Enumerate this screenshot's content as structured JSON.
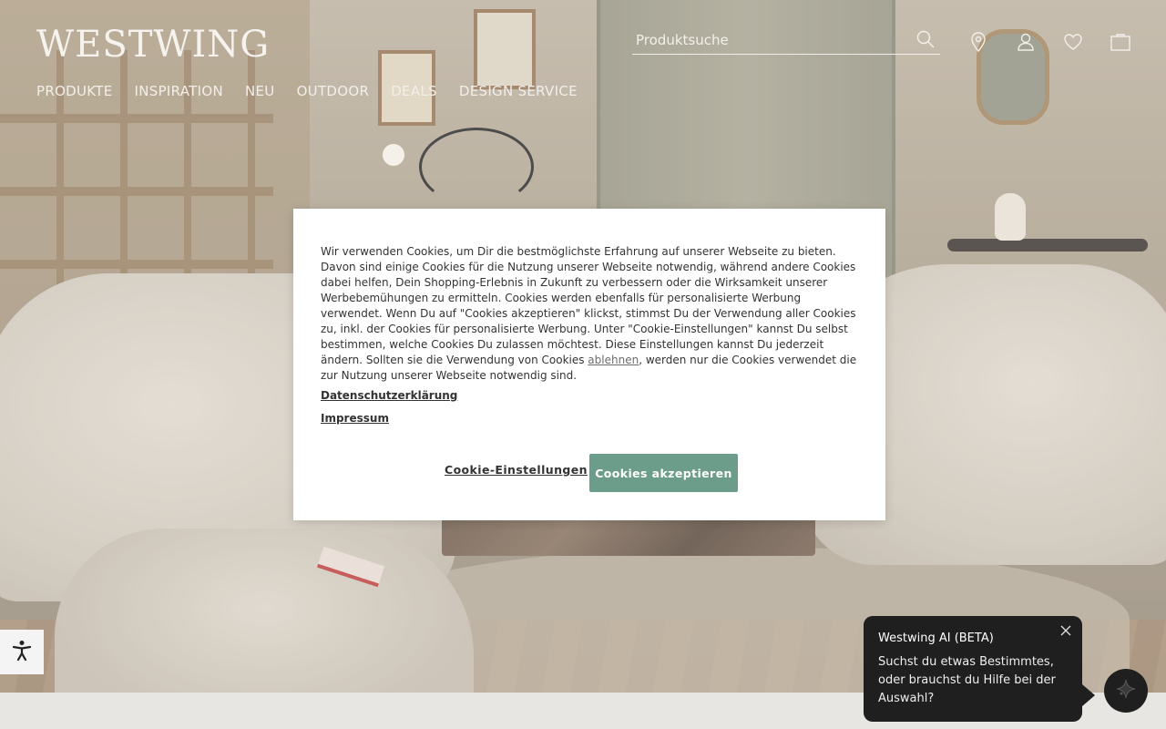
{
  "brand": {
    "logo_text": "WESTWING"
  },
  "nav": {
    "items": [
      {
        "label": "PRODUKTE"
      },
      {
        "label": "INSPIRATION"
      },
      {
        "label": "NEU"
      },
      {
        "label": "OUTDOOR"
      },
      {
        "label": "DEALS"
      },
      {
        "label": "DESIGN SERVICE"
      }
    ]
  },
  "search": {
    "placeholder": "Produktsuche"
  },
  "header_icons": [
    "location-icon",
    "user-icon",
    "heart-icon",
    "bag-icon"
  ],
  "cookie": {
    "text_before_link": "Wir verwenden Cookies, um Dir die bestmöglichste Erfahrung auf unserer Webseite zu bieten. Davon sind einige Cookies für die Nutzung unserer Webseite notwendig, während andere Cookies dabei helfen, Dein Shopping-Erlebnis in Zukunft zu verbessern oder die Wirksamkeit unserer Werbebemühungen zu ermitteln. Cookies werden ebenfalls für personalisierte Werbung verwendet. Wenn Du auf \"Cookies akzeptieren\" klickst, stimmst Du der Verwendung aller Cookies zu, inkl. der Cookies für personalisierte Werbung. Unter \"Cookie-Einstellungen\" kannst Du selbst bestimmen, welche Cookies Du zulassen möchtest. Diese Einstellungen kannst Du jederzeit ändern. Sollten sie die Verwendung von Cookies ",
    "reject_link": "ablehnen",
    "text_after_link": ", werden nur die Cookies verwendet die zur Nutzung unserer Webseite notwendig sind.",
    "privacy_link": "Datenschutzerklärung",
    "imprint_link": "Impressum",
    "settings_button": "Cookie-Einstellungen",
    "accept_button": "Cookies akzeptieren",
    "accent_color": "#6c9c8a"
  },
  "ai": {
    "title": "Westwing AI (BETA)",
    "message": "Suchst du etwas Bestimmtes, oder brauchst du Hilfe bei der Auswahl?"
  }
}
